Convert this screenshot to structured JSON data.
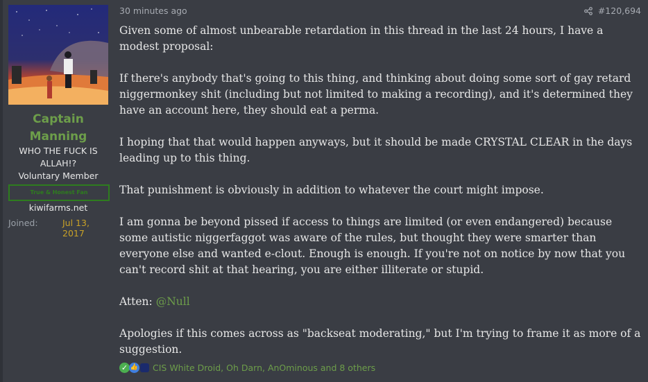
{
  "author": {
    "username": "Captain Manning",
    "user_title": "WHO THE FUCK IS ALLAH!?",
    "role": "Voluntary Member",
    "banner": "True & Honest Fan",
    "site": "kiwifarms.net",
    "joined_label": "Joined:",
    "joined_value": "Jul 13, 2017"
  },
  "post": {
    "time": "30 minutes ago",
    "post_number": "#120,694",
    "paragraphs": [
      "Given some of almost unbearable retardation in this thread in the last 24 hours, I have a modest proposal:",
      "If there's anybody that's going to this thing, and thinking about doing some sort of gay retard niggermonkey shit (including but not limited to making a recording), and it's determined they have an account here, they should eat a perma.",
      "I hoping that that would happen anyways, but it should be made CRYSTAL CLEAR in the days leading up to this thing.",
      "That punishment is obviously in addition to whatever the court might impose.",
      "I am gonna be beyond pissed if access to things are limited (or even endangered) because some autistic niggerfaggot was aware of the rules, but thought they were smarter than everyone else and wanted e-clout. Enough is enough. If you're not on notice by now that you can't record shit at that hearing, you are either illiterate or stupid."
    ],
    "atten_label": "Atten:",
    "mention": "@Null",
    "last_paragraph": "Apologies if this comes across as \"backseat moderating,\" but I'm trying to frame it as more of a suggestion."
  },
  "reactions": {
    "names": "CIS White Droid, Oh Darn, AnOminous and 8 others",
    "icons": [
      "check-icon",
      "thumbs-up-icon",
      "hat-icon"
    ]
  },
  "colors": {
    "accent_green": "#6d9e4a",
    "background": "#3a3d44",
    "text": "#e7e7e7",
    "joined_date": "#c9a227"
  }
}
